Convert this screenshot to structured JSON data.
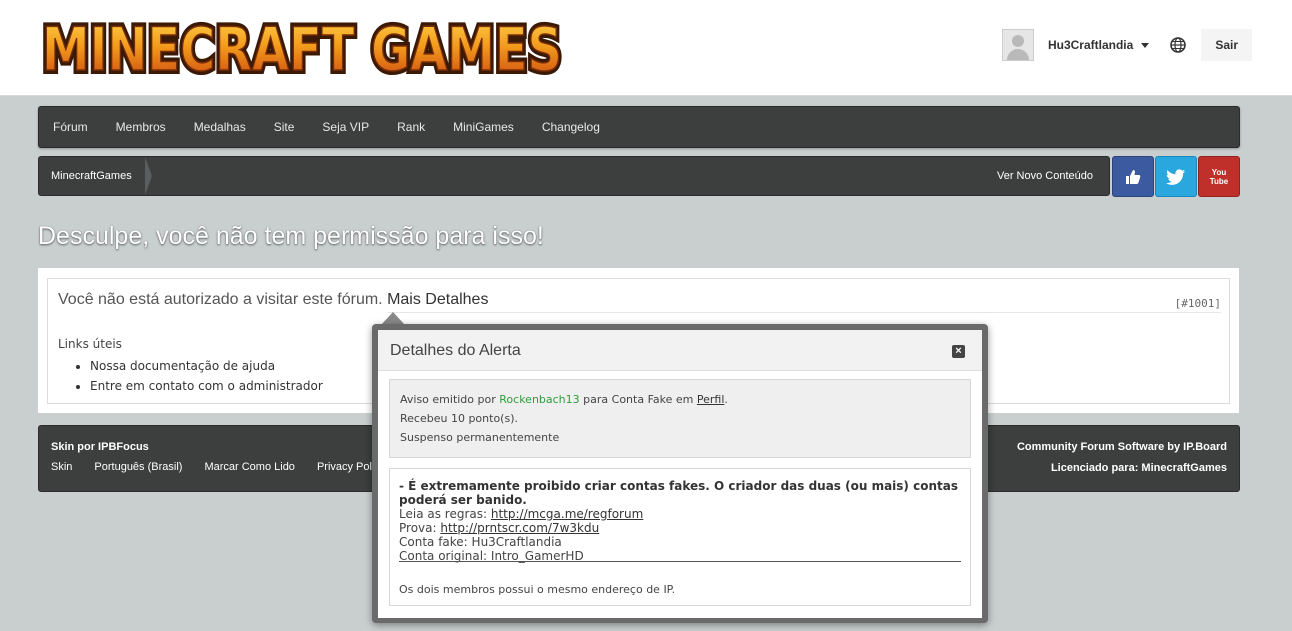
{
  "header": {
    "logo_text": "MINECRAFT GAMES",
    "username": "Hu3Craftlandia",
    "logout_label": "Sair",
    "avatar_icon": "default-avatar-icon",
    "language_icon": "globe-icon"
  },
  "nav": {
    "items": [
      {
        "label": "Fórum"
      },
      {
        "label": "Membros"
      },
      {
        "label": "Medalhas"
      },
      {
        "label": "Site"
      },
      {
        "label": "Seja VIP"
      },
      {
        "label": "Rank"
      },
      {
        "label": "MiniGames"
      },
      {
        "label": "Changelog"
      }
    ]
  },
  "breadcrumb": {
    "home": "MinecraftGames",
    "new_content": "Ver Novo Conteúdo"
  },
  "social": {
    "facebook_icon": "facebook-like-icon",
    "twitter_icon": "twitter-icon",
    "youtube_label": "You Tube",
    "colors": {
      "facebook": "#3b5aa0",
      "twitter": "#2aa7df",
      "youtube": "#c0302b"
    }
  },
  "page": {
    "title": "Desculpe, você não tem permissão para isso!",
    "message": "Você não está autorizado a visitar este fórum.",
    "details_link": "Mais Detalhes",
    "error_code": "[#1001]",
    "links_title": "Links úteis",
    "links": [
      "Nossa documentação de ajuda",
      "Entre em contato com o administrador"
    ]
  },
  "footer": {
    "skin_by": "Skin por IPBFocus",
    "links": [
      "Skin",
      "Português (Brasil)",
      "Marcar Como Lido",
      "Privacy Poli"
    ],
    "software": "Community Forum Software by IP.Board",
    "license": "Licenciado para: MinecraftGames"
  },
  "modal": {
    "title": "Detalhes do Alerta",
    "close_icon": "close-icon",
    "warning": {
      "prefix": "Aviso emitido por",
      "moderator": "Rockenbach13",
      "middle": "para Conta Fake em",
      "location_link": "Perfil",
      "suffix": ".",
      "points": "Recebeu 10 ponto(s).",
      "status": "Suspenso permanentemente"
    },
    "reason": {
      "headline": "- É extremamente proibido criar contas fakes. O criador das duas (ou mais) contas poderá ser banido.",
      "rules_label": "Leia as regras:",
      "rules_link": "http://mcga.me/regforum",
      "proof_label": "Prova:",
      "proof_link": "http://prntscr.com/7w3kdu",
      "fake_account": "Conta fake: Hu3Craftlandia",
      "original_account": "Conta original: Intro_GamerHD",
      "note": "Os dois membros possui o mesmo endereço de IP."
    }
  }
}
